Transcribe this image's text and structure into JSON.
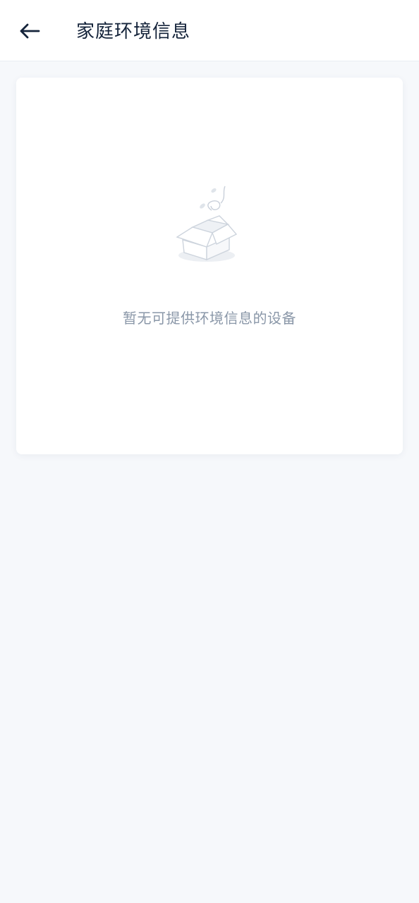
{
  "header": {
    "back_icon": "arrow-left-icon",
    "title": "家庭环境信息"
  },
  "empty_state": {
    "illustration": "empty-box-icon",
    "message": "暂无可提供环境信息的设备"
  },
  "colors": {
    "background": "#f6f8fb",
    "card": "#ffffff",
    "title_text": "#14233a",
    "muted_text": "#8a97a8"
  }
}
